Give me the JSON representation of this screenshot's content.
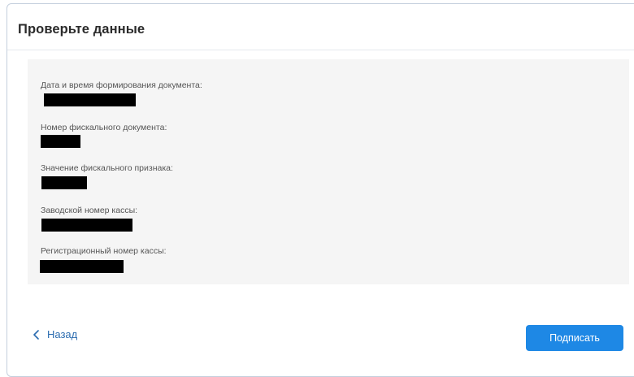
{
  "header": {
    "title": "Проверьте данные"
  },
  "fields": [
    {
      "label": "Дата и время формирования документа:",
      "value_state": "redacted"
    },
    {
      "label": "Номер фискального документа:",
      "value_state": "redacted"
    },
    {
      "label": "Значение фискального признака:",
      "value_state": "redacted"
    },
    {
      "label": "Заводской номер кассы:",
      "value_state": "redacted"
    },
    {
      "label": "Регистрационный номер кассы:",
      "value_state": "redacted"
    }
  ],
  "footer": {
    "back_label": "Назад",
    "back_icon": "chevron-left-icon",
    "sign_label": "Подписать"
  },
  "colors": {
    "accent": "#1e88e5",
    "link": "#2b6cb0",
    "panel_bg": "#f5f5f5",
    "redaction": "#000000"
  }
}
